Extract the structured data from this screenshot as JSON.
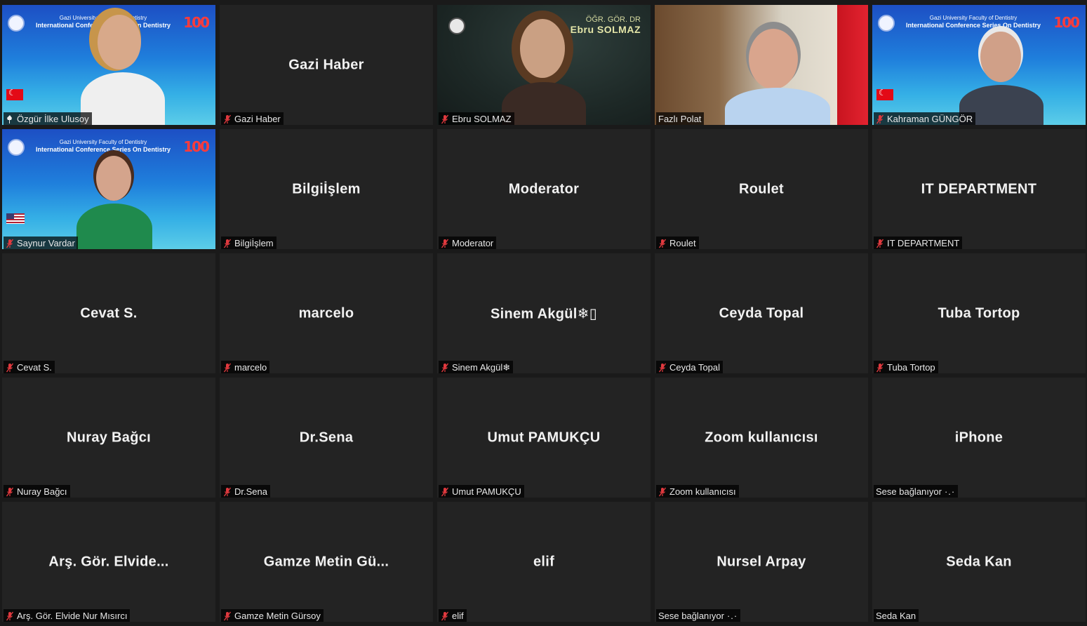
{
  "participants": [
    {
      "label": "Özgür İlke Ulusoy",
      "muted": false,
      "pinned": true
    },
    {
      "tile": "Gazi Haber",
      "label": "Gazi Haber",
      "muted": true
    },
    {
      "label": "Ebru SOLMAZ",
      "muted": true,
      "overlay_line1": "ÖĞR. GÖR. DR",
      "overlay_line2": "Ebru SOLMAZ"
    },
    {
      "label": "Fazlı Polat",
      "muted": false
    },
    {
      "label": "Kahraman GÜNGÖR",
      "muted": true
    },
    {
      "label": "Saynur Vardar",
      "muted": true
    },
    {
      "tile": "Bilgiİşlem",
      "label": "Bilgiİşlem",
      "muted": true
    },
    {
      "tile": "Moderator",
      "label": "Moderator",
      "muted": true
    },
    {
      "tile": "Roulet",
      "label": "Roulet",
      "muted": true
    },
    {
      "tile": "IT DEPARTMENT",
      "label": "IT DEPARTMENT",
      "muted": true
    },
    {
      "tile": "Cevat S.",
      "label": "Cevat S.",
      "muted": true
    },
    {
      "tile": "marcelo",
      "label": "marcelo",
      "muted": true
    },
    {
      "tile": "Sinem  Akgül❄▯",
      "label": "Sinem Akgül❄",
      "muted": true
    },
    {
      "tile": "Ceyda Topal",
      "label": "Ceyda Topal",
      "muted": true
    },
    {
      "tile": "Tuba Tortop",
      "label": "Tuba Tortop",
      "muted": true
    },
    {
      "tile": "Nuray Bağcı",
      "label": "Nuray Bağcı",
      "muted": true
    },
    {
      "tile": "Dr.Sena",
      "label": "Dr.Sena",
      "muted": true
    },
    {
      "tile": "Umut PAMUKÇU",
      "label": "Umut PAMUKÇU",
      "muted": true
    },
    {
      "tile": "Zoom kullanıcısı",
      "label": "Zoom kullanıcısı",
      "muted": true
    },
    {
      "tile": "iPhone",
      "label": "Sese bağlanıyor",
      "muted": false,
      "connecting": true
    },
    {
      "tile": "Arş. Gör. Elvide...",
      "label": "Arş. Gör. Elvide Nur Mısırcı",
      "muted": true
    },
    {
      "tile": "Gamze Metin Gü...",
      "label": "Gamze Metin Gürsoy",
      "muted": true
    },
    {
      "tile": "elif",
      "label": "elif",
      "muted": true
    },
    {
      "tile": "Nursel Arpay",
      "label": "Sese bağlanıyor",
      "muted": false,
      "connecting": true
    },
    {
      "tile": "Seda Kan",
      "label": "Seda Kan",
      "muted": false
    }
  ],
  "conference": {
    "line1": "Gazi University Faculty of Dentistry",
    "line2": "International Conference Series On Dentistry",
    "badge": "100"
  },
  "connecting_suffix": "·.·",
  "colors": {
    "tile_bg": "#232323",
    "active_border": "#c9e26b",
    "muted_icon": "#e0393e"
  }
}
